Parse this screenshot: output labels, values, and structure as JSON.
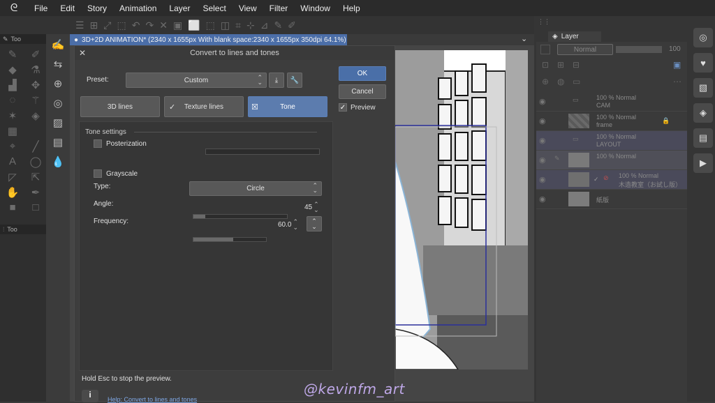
{
  "menu": {
    "items": [
      "File",
      "Edit",
      "Story",
      "Animation",
      "Layer",
      "Select",
      "View",
      "Filter",
      "Window",
      "Help"
    ]
  },
  "left_panel": {
    "tool_tab_label": "Too",
    "sub_tab_label": "Too"
  },
  "document": {
    "tab_title": "3D+2D ANIMATION* (2340 x 1655px With blank space:2340 x 1655px 350dpi 64.1%)"
  },
  "dialog": {
    "title": "Convert to lines and tones",
    "preset_label": "Preset:",
    "preset_value": "Custom",
    "ok_label": "OK",
    "cancel_label": "Cancel",
    "preview_label": "Preview",
    "preview_checked": true,
    "tabs": [
      {
        "label": "3D lines",
        "checked": false,
        "active": false
      },
      {
        "label": "Texture lines",
        "checked": true,
        "active": false
      },
      {
        "label": "Tone",
        "checked": true,
        "active": true
      }
    ],
    "tone_settings": {
      "header": "Tone settings",
      "posterization_label": "Posterization",
      "posterization_checked": false,
      "grayscale_label": "Grayscale",
      "grayscale_checked": false,
      "type_label": "Type:",
      "type_value": "Circle",
      "angle_label": "Angle:",
      "angle_value": "45",
      "angle_fraction": 0.13,
      "frequency_label": "Frequency:",
      "frequency_value": "60.0",
      "frequency_fraction": 0.55
    },
    "hint_text": "Hold Esc to stop the preview.",
    "help_link": "Help: Convert to lines and tones"
  },
  "layer_panel": {
    "tab_label": "Layer",
    "blend_mode": "Normal",
    "opacity": "100",
    "layers": [
      {
        "line1": "100 % Normal",
        "line2": "CAM"
      },
      {
        "line1": "100 % Normal",
        "line2": "frame"
      },
      {
        "line1": "100 % Normal",
        "line2": "LAYOUT"
      },
      {
        "line1": "100 % Normal",
        "line2": ""
      },
      {
        "line1": "100 % Normal",
        "line2": "木造教室（お試し版）"
      },
      {
        "line1": "",
        "line2": "紙版"
      }
    ]
  },
  "watermark": "@kevinfm_art",
  "colors": {
    "accent": "#4a6fa8",
    "dialog_bg": "#3d3d3d",
    "menubar_bg": "#2b2b2b",
    "watermark": "#bfa8e8"
  }
}
